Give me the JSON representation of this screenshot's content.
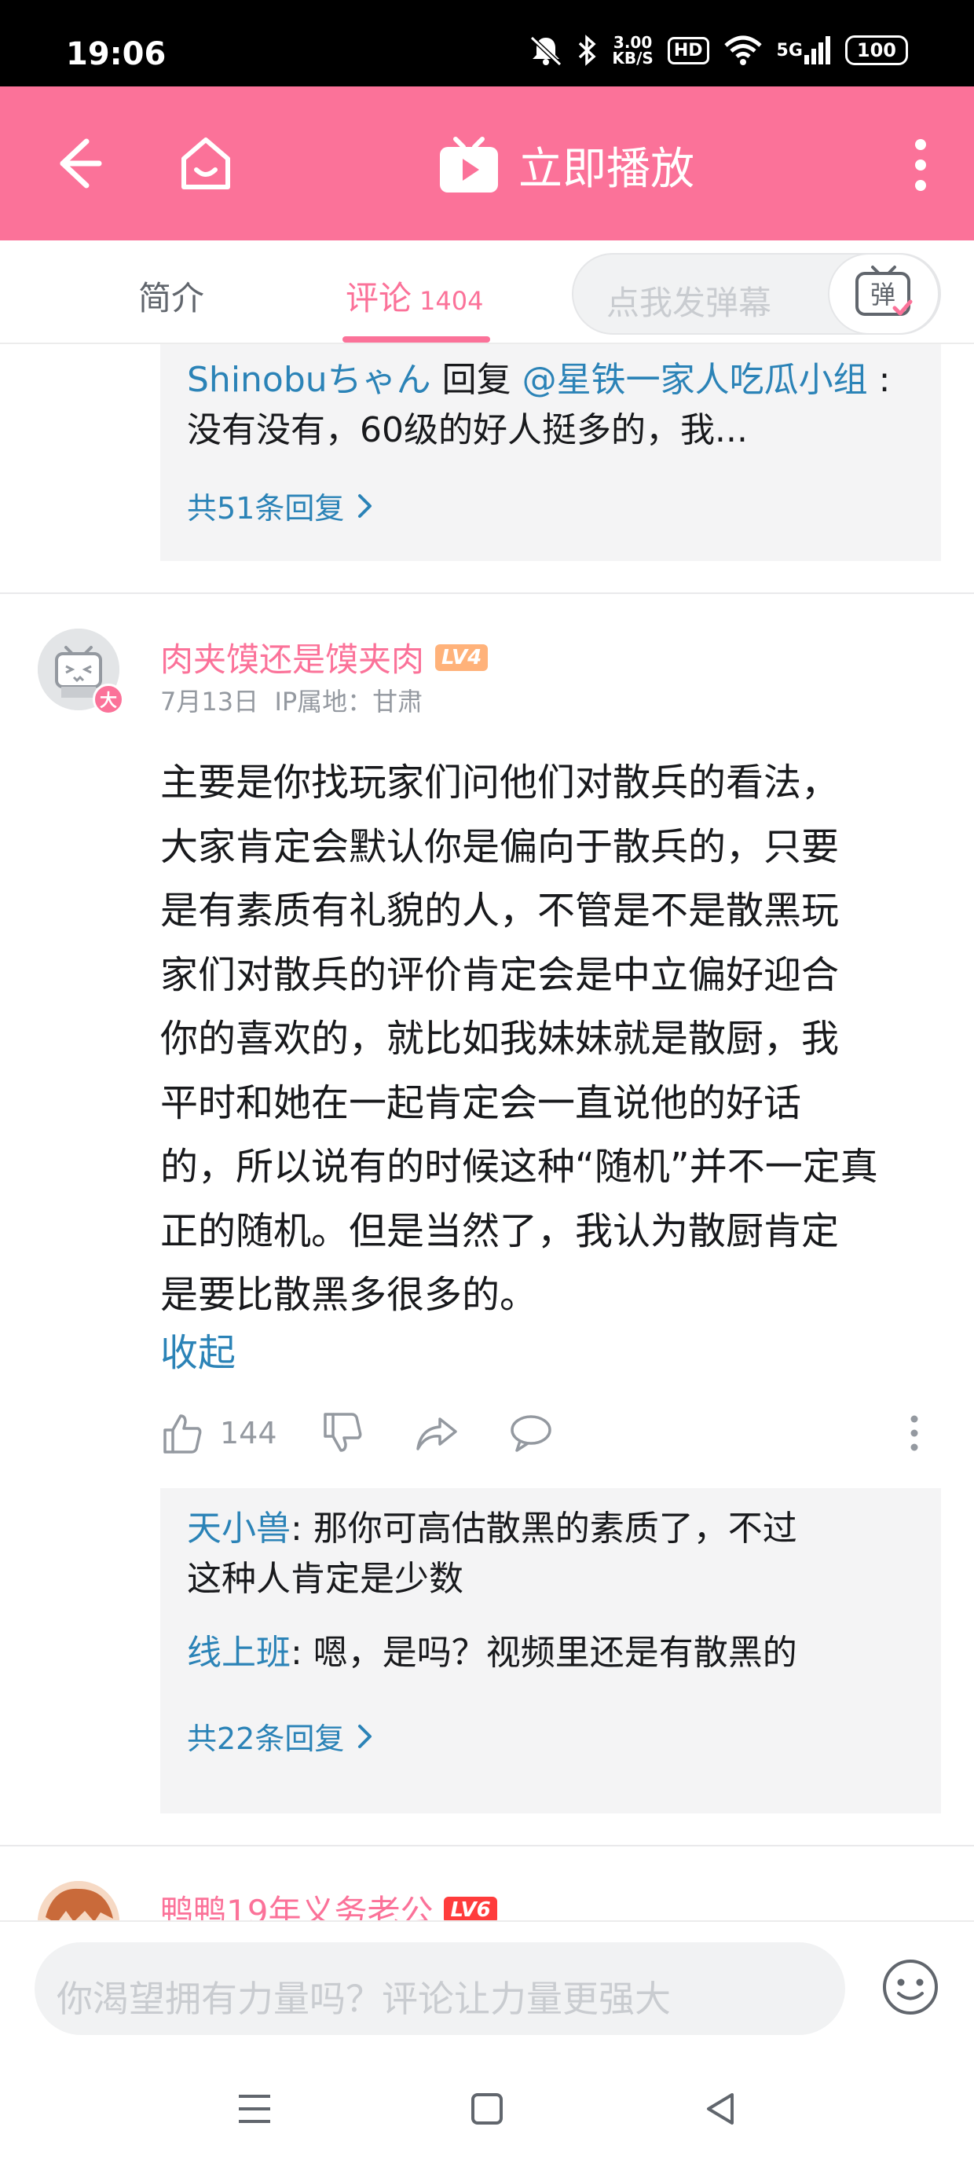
{
  "status_bar": {
    "time": "19:06",
    "network_speed_top": "3.00",
    "network_speed_bottom": "KB/S",
    "hd_label": "HD",
    "signal_label": "5G",
    "battery": "100"
  },
  "header": {
    "play_label": "立即播放",
    "brand_color": "#fb7299"
  },
  "tabs": {
    "intro_label": "简介",
    "comments_label": "评论",
    "comments_count": "1404",
    "danmaku_placeholder": "点我发弹幕",
    "danmaku_button_label": "弹"
  },
  "comments": [
    {
      "replies": [
        {
          "user": "Shinobuちゃん",
          "reply_word": " 回复 ",
          "target": "@星铁一家人吃瓜小组",
          "text": " :没有没有，60级的好人挺多的，我..."
        }
      ],
      "more_replies": "共51条回复"
    },
    {
      "avatar_badge": "大",
      "username": "肉夹馍还是馍夹肉",
      "level": "LV4",
      "date": "7月13日",
      "ip": "IP属地：甘肃",
      "lines": [
        "主要是你找玩家们问他们对散兵的看法，",
        "大家肯定会默认你是偏向于散兵的，只要",
        "是有素质有礼貌的人，不管是不是散黑玩",
        "家们对散兵的评价肯定会是中立偏好迎合",
        "你的喜欢的，就比如我妹妹就是散厨，我",
        "平时和她在一起肯定会一直说他的好话",
        "的，所以说有的时候这种“随机”并不一定真",
        "正的随机。但是当然了，我认为散厨肯定",
        "是要比散黑多很多的。"
      ],
      "collapse_label": "收起",
      "like_count": "144",
      "replies": [
        {
          "user": "天小兽",
          "text_line1": ": 那你可高估散黑的素质了，不过",
          "text_line2": "这种人肯定是少数"
        },
        {
          "user": "线上班",
          "text": ": 嗯，是吗？视频里还是有散黑的"
        }
      ],
      "more_replies": "共22条回复"
    },
    {
      "username": "鸭鸭19年义务老公",
      "level": "LV6"
    }
  ],
  "composer": {
    "placeholder": "你渴望拥有力量吗？评论让力量更强大"
  }
}
